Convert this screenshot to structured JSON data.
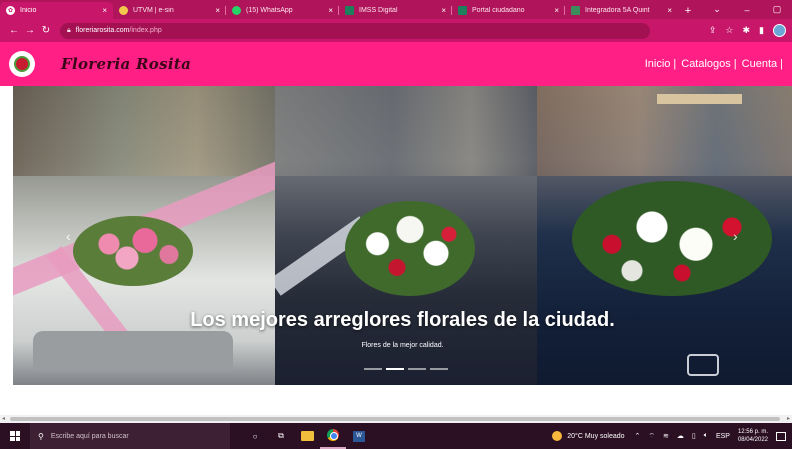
{
  "browser": {
    "tabs": [
      {
        "title": "Inicio",
        "active": true
      },
      {
        "title": "UTVM | e-sin",
        "active": false
      },
      {
        "title": "(15) WhatsApp",
        "active": false
      },
      {
        "title": "IMSS Digital",
        "active": false
      },
      {
        "title": "Portal ciudadano",
        "active": false
      },
      {
        "title": "Integradora 5A Quint",
        "active": false
      }
    ],
    "address": {
      "host": "floreriarosita.com",
      "path": "/index.php"
    }
  },
  "site": {
    "brand": "Floreria Rosita",
    "nav": [
      {
        "label": "Inicio"
      },
      {
        "label": "Catalogos"
      },
      {
        "label": "Cuenta"
      }
    ],
    "nav_separator": "|",
    "hero": {
      "title": "Los mejores arreglores florales de la ciudad.",
      "subtitle": "Flores de la mejor calidad.",
      "slide_count": 4,
      "active_slide": 2
    }
  },
  "taskbar": {
    "search_placeholder": "Escribe aquí para buscar",
    "weather": "20°C  Muy soleado",
    "language": "ESP",
    "time": "12:56 p. m.",
    "date": "08/04/2022"
  },
  "colors": {
    "header_pink": "#ff1f85",
    "browser_chrome": "#c8176a",
    "brand_text": "#3a0618"
  }
}
